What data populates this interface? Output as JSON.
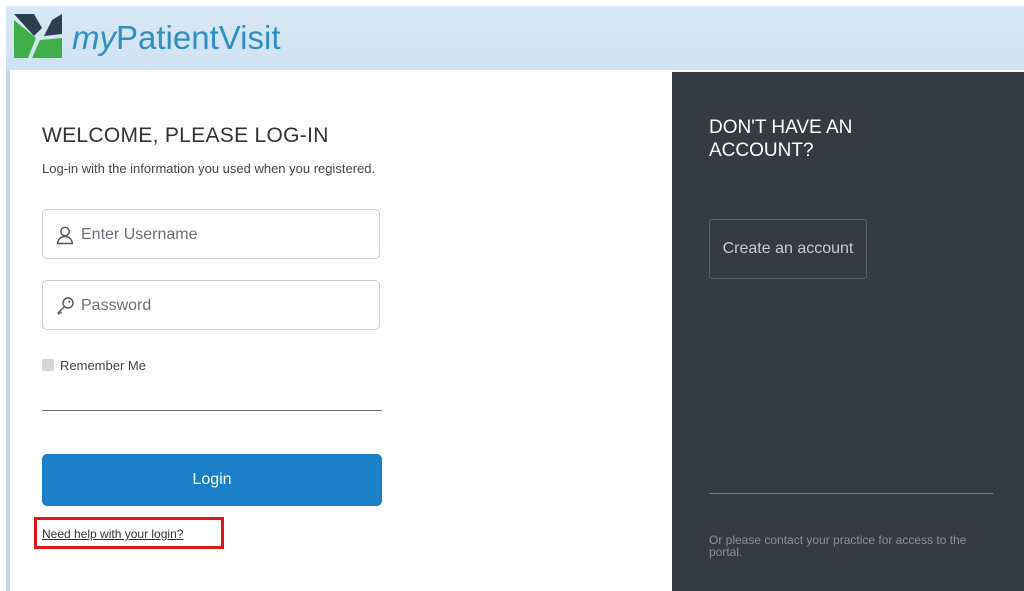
{
  "header": {
    "logo_prefix": "my",
    "logo_name": "PatientVisit"
  },
  "login": {
    "title": "WELCOME, PLEASE LOG-IN",
    "subtitle": "Log-in with the information you used when you registered.",
    "username_placeholder": "Enter Username",
    "username_value": "",
    "password_placeholder": "Password",
    "password_value": "",
    "remember_label": "Remember Me",
    "remember_checked": false,
    "login_button": "Login",
    "help_link": "Need help with your login?"
  },
  "signup": {
    "title": "DON'T HAVE AN ACCOUNT?",
    "create_button": "Create an account",
    "contact_note": "Or please contact your practice for access to the portal."
  },
  "colors": {
    "primary_button": "#1b7fc7",
    "dark_panel": "#363a42",
    "header_bg": "#cfe2f1",
    "highlight_box": "#e01515",
    "logo_green": "#3fae49",
    "logo_dark": "#2c3e50"
  },
  "icons": {
    "username": "user-icon",
    "password": "key-icon"
  }
}
